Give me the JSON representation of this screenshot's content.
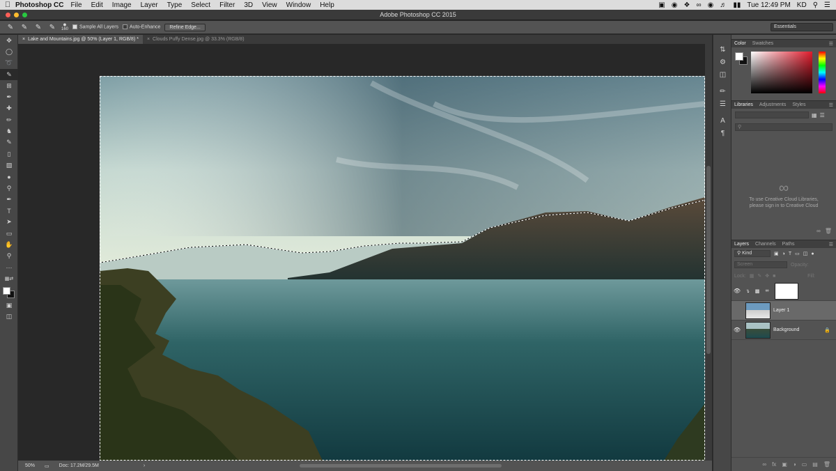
{
  "menubar": {
    "app_name": "Photoshop CC",
    "items": [
      "File",
      "Edit",
      "Image",
      "Layer",
      "Type",
      "Select",
      "Filter",
      "3D",
      "View",
      "Window",
      "Help"
    ],
    "clock": "Tue 12:49 PM",
    "user": "KD"
  },
  "window": {
    "title": "Adobe Photoshop CC 2015"
  },
  "options": {
    "brush_size": "160",
    "sample_all_layers": "Sample All Layers",
    "auto_enhance": "Auto-Enhance",
    "refine_edge": "Refine Edge...",
    "workspace": "Essentials"
  },
  "doc_tabs": [
    {
      "label": "Lake and Mountains.jpg @ 50% (Layer 1, RGB/8) *"
    },
    {
      "label": "Clouds Puffy Dense.jpg @ 33.3% (RGB/8)"
    }
  ],
  "status": {
    "zoom": "50%",
    "doc": "Doc: 17.2M/29.5M"
  },
  "color_panel": {
    "tabs": [
      "Color",
      "Swatches"
    ],
    "fg": "#ffffff",
    "bg": "#111111"
  },
  "libraries_panel": {
    "tabs": [
      "Libraries",
      "Adjustments",
      "Styles"
    ],
    "message_line1": "To use Creative Cloud Libraries,",
    "message_line2": "please sign in to Creative Cloud"
  },
  "layers_panel": {
    "tabs": [
      "Layers",
      "Channels",
      "Paths"
    ],
    "filter": "Kind",
    "blend_mode": "Screen",
    "opacity_label": "Opacity:",
    "lock_label": "Lock:",
    "fill_label": "Fill:",
    "layers": [
      {
        "name": "",
        "type": "adjustment"
      },
      {
        "name": "Layer 1",
        "type": "pixel"
      },
      {
        "name": "Background",
        "type": "background"
      }
    ]
  }
}
